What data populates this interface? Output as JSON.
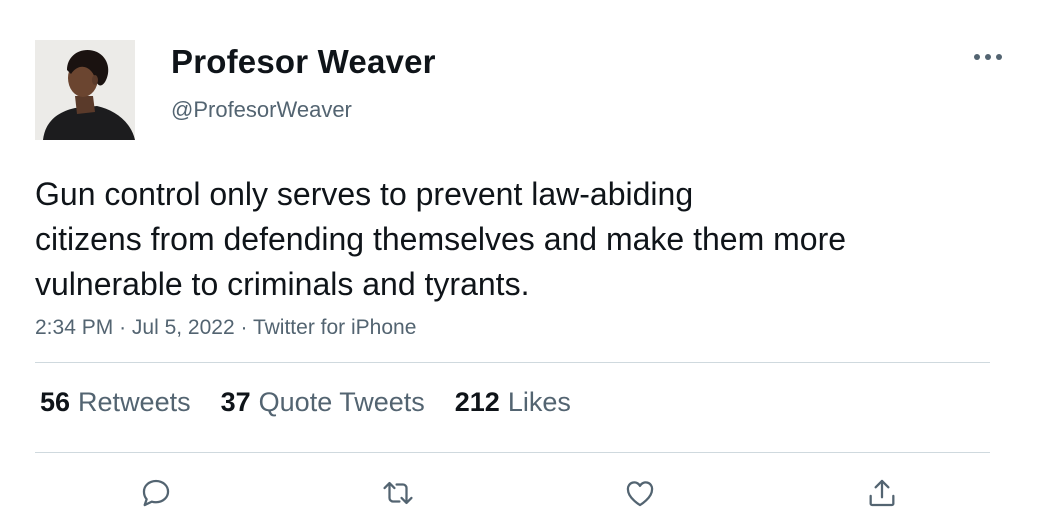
{
  "author": {
    "display_name": "Profesor Weaver",
    "handle": "@ProfesorWeaver",
    "avatar_icon": "profile-photo"
  },
  "tweet": {
    "text_lines": [
      "Gun control only serves to prevent law-abiding",
      "citizens from defending themselves and make them more",
      "vulnerable to criminals and tyrants."
    ],
    "time": "2:34 PM",
    "separator": "·",
    "date": "Jul 5, 2022",
    "source": "Twitter for iPhone"
  },
  "stats": {
    "retweets": {
      "count": "56",
      "label": "Retweets"
    },
    "quote_tweets": {
      "count": "37",
      "label": "Quote Tweets"
    },
    "likes": {
      "count": "212",
      "label": "Likes"
    }
  },
  "actions": [
    "reply-icon",
    "retweet-icon",
    "like-icon",
    "share-icon"
  ],
  "more_icon": "more-options-icon",
  "colors": {
    "text_primary": "#0f1419",
    "text_secondary": "#536471",
    "divider": "#cfd9de",
    "background": "#ffffff"
  }
}
